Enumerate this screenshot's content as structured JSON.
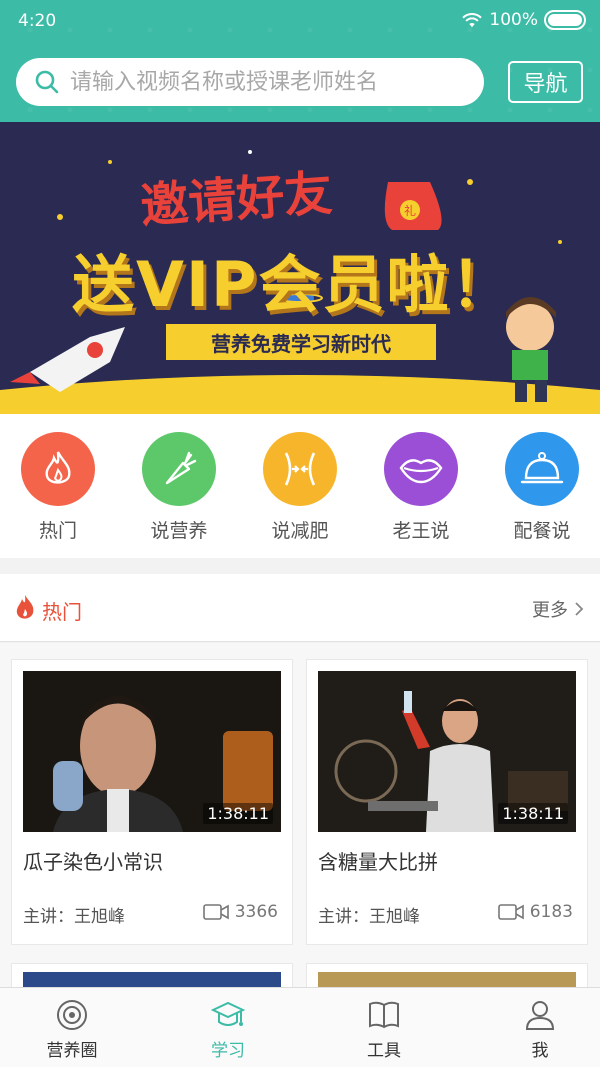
{
  "status": {
    "time": "4:20",
    "battery": "100%"
  },
  "search": {
    "placeholder": "请输入视频名称或授课老师姓名"
  },
  "header": {
    "nav_label": "导航"
  },
  "banner": {
    "line1": "邀请好友",
    "line2": "送VIP会员啦！",
    "ribbon": "营养免费学习新时代",
    "bag_mark": "礼"
  },
  "categories": [
    {
      "label": "热门",
      "icon": "flame-icon",
      "color": "#f4644a"
    },
    {
      "label": "说营养",
      "icon": "carrot-icon",
      "color": "#5cc86a"
    },
    {
      "label": "说减肥",
      "icon": "waist-icon",
      "color": "#f7b52c"
    },
    {
      "label": "老王说",
      "icon": "lips-icon",
      "color": "#9a4fd6"
    },
    {
      "label": "配餐说",
      "icon": "cloche-icon",
      "color": "#2f97ec"
    }
  ],
  "hot": {
    "title": "热门",
    "more": "更多"
  },
  "videos": [
    {
      "title": "瓜子染色小常识",
      "duration": "1:38:11",
      "lecturer": "主讲：王旭峰",
      "views": "3366"
    },
    {
      "title": "含糖量大比拼",
      "duration": "1:38:11",
      "lecturer": "主讲：王旭峰",
      "views": "6183"
    }
  ],
  "tabs": [
    {
      "label": "营养圈",
      "icon": "circle-target-icon"
    },
    {
      "label": "学习",
      "icon": "graduation-cap-icon"
    },
    {
      "label": "工具",
      "icon": "book-icon"
    },
    {
      "label": "我",
      "icon": "person-icon"
    }
  ],
  "colors": {
    "primary": "#3cbba6",
    "hot": "#e8523a"
  }
}
